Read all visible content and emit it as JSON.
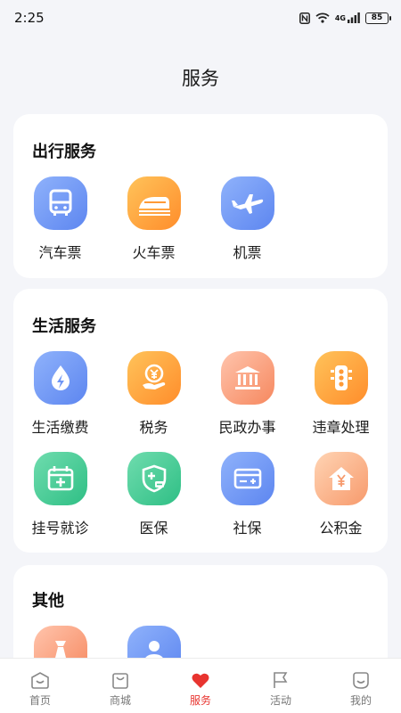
{
  "status": {
    "time": "2:25",
    "network": "4G",
    "battery": "85"
  },
  "page": {
    "title": "服务"
  },
  "sections": [
    {
      "title": "出行服务",
      "items": [
        {
          "label": "汽车票",
          "icon": "bus-icon",
          "color": "#6f96f5"
        },
        {
          "label": "火车票",
          "icon": "train-icon",
          "color": "#ffa33f"
        },
        {
          "label": "机票",
          "icon": "airplane-icon",
          "color": "#6f96f5"
        }
      ]
    },
    {
      "title": "生活服务",
      "items": [
        {
          "label": "生活缴费",
          "icon": "water-bolt-icon",
          "color": "#6f96f5"
        },
        {
          "label": "税务",
          "icon": "yuan-hand-icon",
          "color": "#ffa33f"
        },
        {
          "label": "民政办事",
          "icon": "government-building-icon",
          "color": "#f6956c"
        },
        {
          "label": "违章处理",
          "icon": "traffic-light-icon",
          "color": "#ffa33f"
        },
        {
          "label": "挂号就诊",
          "icon": "medical-calendar-icon",
          "color": "#3fc890"
        },
        {
          "label": "医保",
          "icon": "medical-shield-icon",
          "color": "#3fc890"
        },
        {
          "label": "社保",
          "icon": "social-security-card-icon",
          "color": "#6f96f5"
        },
        {
          "label": "公积金",
          "icon": "yuan-house-icon",
          "color": "#f79a6c"
        }
      ]
    },
    {
      "title": "其他",
      "items": [
        {
          "label": "",
          "icon": "necktie-icon",
          "color": "#f6956c"
        },
        {
          "label": "",
          "icon": "person-icon",
          "color": "#6f96f5"
        }
      ]
    }
  ],
  "tabs": [
    {
      "label": "首页",
      "icon": "home-icon",
      "active": false
    },
    {
      "label": "商城",
      "icon": "shopping-bag-icon",
      "active": false
    },
    {
      "label": "服务",
      "icon": "heart-icon",
      "active": true
    },
    {
      "label": "活动",
      "icon": "flag-icon",
      "active": false
    },
    {
      "label": "我的",
      "icon": "smiley-icon",
      "active": false
    }
  ],
  "colors": {
    "accent": "#e8342f",
    "background": "#f4f5f9"
  }
}
